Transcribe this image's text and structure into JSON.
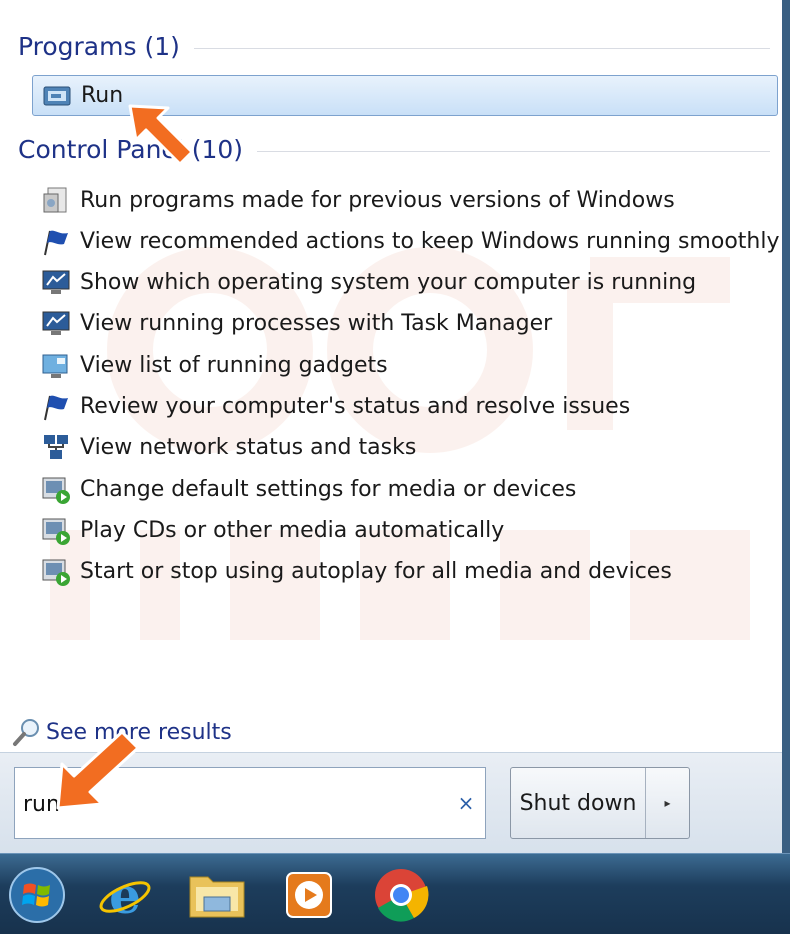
{
  "programs": {
    "title": "Programs (1)",
    "items": [
      {
        "label": "Run",
        "icon": "run-icon",
        "selected": true
      }
    ]
  },
  "control_panel": {
    "title": "Control Panel (10)",
    "items": [
      {
        "label": "Run programs made for previous versions of Windows",
        "icon": "program-compatibility-icon"
      },
      {
        "label": "View recommended actions to keep Windows running smoothly",
        "icon": "action-center-flag-icon"
      },
      {
        "label": "Show which operating system your computer is running",
        "icon": "system-monitor-icon"
      },
      {
        "label": "View running processes with Task Manager",
        "icon": "system-monitor-icon"
      },
      {
        "label": "View list of running gadgets",
        "icon": "gadgets-icon"
      },
      {
        "label": "Review your computer's status and resolve issues",
        "icon": "action-center-flag-icon"
      },
      {
        "label": "View network status and tasks",
        "icon": "network-icon"
      },
      {
        "label": "Change default settings for media or devices",
        "icon": "autoplay-icon"
      },
      {
        "label": "Play CDs or other media automatically",
        "icon": "autoplay-icon"
      },
      {
        "label": "Start or stop using autoplay for all media and devices",
        "icon": "autoplay-icon"
      }
    ]
  },
  "see_more": {
    "label": "See more results",
    "icon": "magnifier-icon"
  },
  "search": {
    "value": "run",
    "clear_glyph": "×"
  },
  "shutdown": {
    "label": "Shut down",
    "arrow_glyph": "▸"
  },
  "taskbar": {
    "items": [
      {
        "name": "start-orb",
        "icon": "windows-logo-icon"
      },
      {
        "name": "internet-explorer",
        "icon": "internet-explorer-icon"
      },
      {
        "name": "windows-explorer",
        "icon": "folder-icon"
      },
      {
        "name": "media-player",
        "icon": "media-player-icon"
      },
      {
        "name": "google-chrome",
        "icon": "chrome-icon"
      }
    ]
  },
  "colors": {
    "header_text": "#1e3287",
    "highlight": "#c9e0f7",
    "arrow": "#f26d21",
    "taskbar": "#1d3d5c"
  }
}
